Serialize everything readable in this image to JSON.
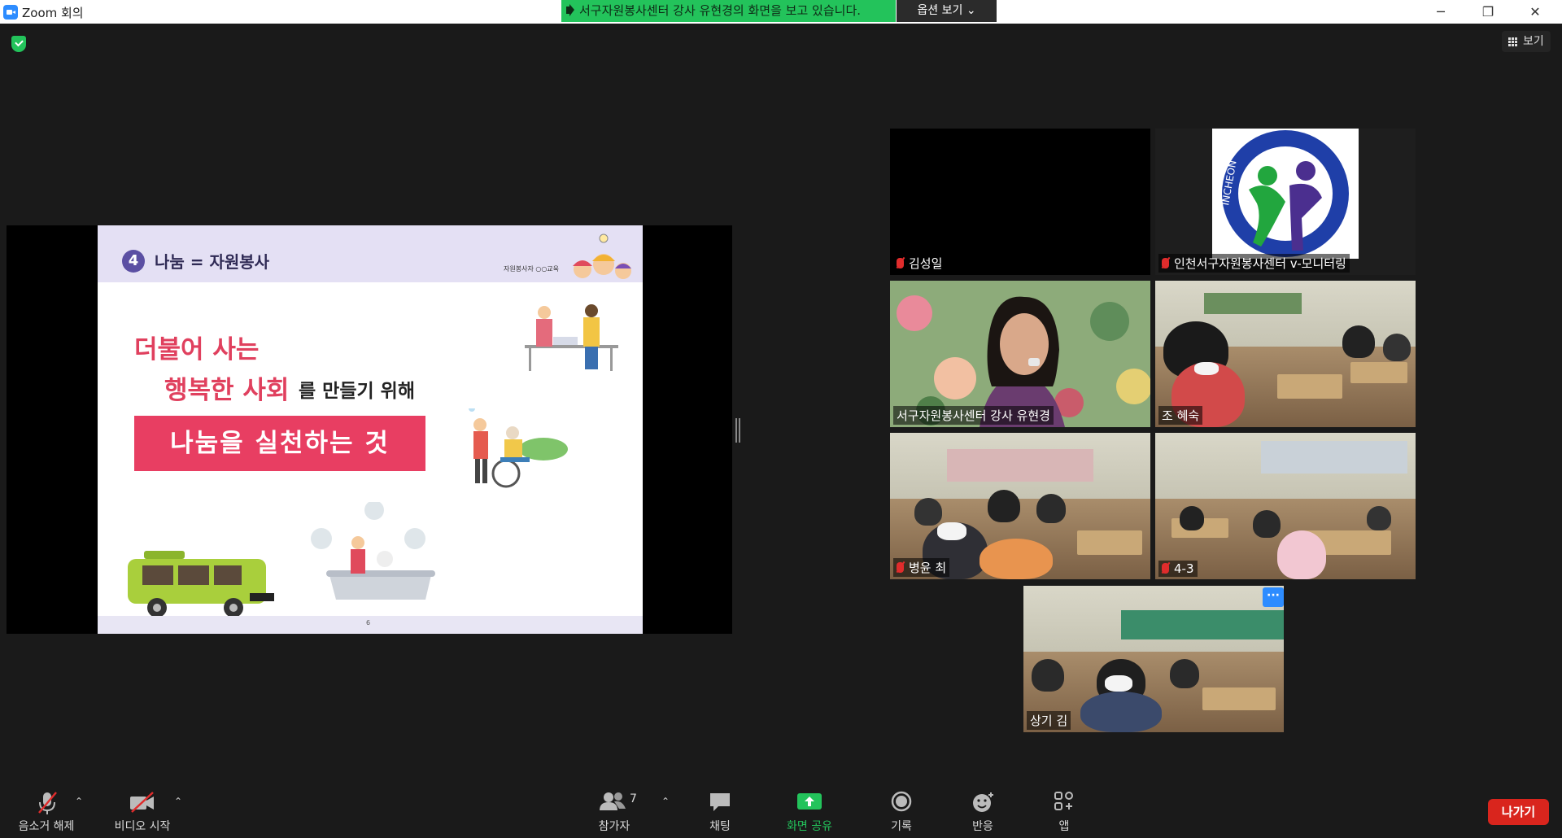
{
  "window": {
    "title": "Zoom 회의",
    "minimize": "─",
    "restore": "❐",
    "close": "✕"
  },
  "share_banner": {
    "text": "서구자원봉사센터 강사 유현경의 화면을 보고 있습니다.",
    "options_label": "옵션 보기 ⌄"
  },
  "view_button": {
    "label": "보기"
  },
  "slide": {
    "section_number": "4",
    "section_title": "나눔 = 자원봉사",
    "logo_text": "자원봉사자 ○○교육",
    "line1": "더불어 사는",
    "line2_highlight": "행복한 사회",
    "line2_rest": "를 만들기 위해",
    "cta": "나눔을 실천하는 것",
    "page_number": "6"
  },
  "participants": [
    {
      "name": "김성일",
      "muted": true
    },
    {
      "name": "인천서구자원봉사센터 v-모니터링",
      "muted": true,
      "logo_text": "INCHEON"
    },
    {
      "name": "서구자원봉사센터 강사 유현경",
      "muted": false,
      "active": true
    },
    {
      "name": "조 혜숙",
      "muted": false
    },
    {
      "name": "병윤 최",
      "muted": true
    },
    {
      "name": "4-3",
      "muted": true
    },
    {
      "name": "상기 김",
      "muted": false
    }
  ],
  "more_button": "···",
  "toolbar": {
    "mute": "음소거 해제",
    "video": "비디오 시작",
    "participants": "참가자",
    "participants_count": "7",
    "chat": "채팅",
    "share": "화면 공유",
    "record": "기록",
    "reactions": "반응",
    "apps": "앱",
    "leave": "나가기",
    "caret": "⌃"
  },
  "colors": {
    "share_green": "#23c35b",
    "leave_red": "#d9251d",
    "active_border": "#e4ea5d",
    "slide_pink": "#e83e62"
  }
}
